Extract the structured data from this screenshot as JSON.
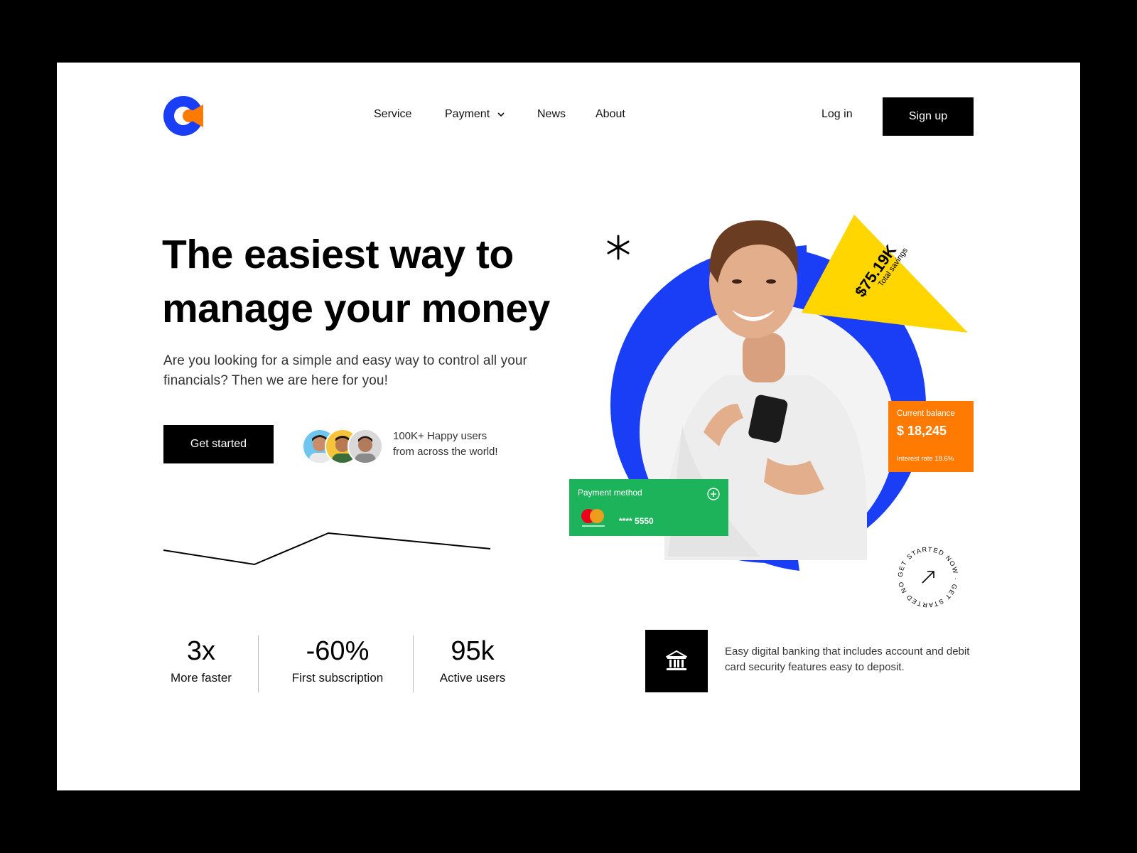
{
  "header": {
    "logo": {
      "icon": "brand-logo-icon",
      "colors": [
        "#1a3ef5",
        "#ff7a00"
      ]
    },
    "nav": [
      {
        "label": "Service"
      },
      {
        "label": "Payment",
        "icon": "chevron-down-icon"
      },
      {
        "label": "News"
      },
      {
        "label": "About"
      }
    ],
    "login_label": "Log in",
    "signup_label": "Sign up"
  },
  "hero": {
    "title": "The easiest way to\nmanage your money",
    "subtitle": "Are you looking for a simple and easy way to control all your financials? Then we are here for you!",
    "cta_label": "Get started",
    "users_line1": "100K+ Happy users",
    "users_line2": "from across the world!"
  },
  "line_chart": {
    "values": [
      20,
      0,
      44,
      22
    ]
  },
  "stats": [
    {
      "value": "3x",
      "label": "More faster"
    },
    {
      "value": "-60%",
      "label": "First subscription"
    },
    {
      "value": "95k",
      "label": "Active users"
    }
  ],
  "feature": {
    "icon": "bank-icon",
    "text": "Easy digital banking that includes account and debit card security features easy to deposit."
  },
  "visual": {
    "savings_value": "$75.19K",
    "savings_label": "Total savings",
    "balance_label": "Current balance",
    "balance_value": "$ 18,245",
    "interest_label": "Interest rate 18.6%",
    "payment_label": "Payment method",
    "card_brand": "mastercard",
    "card_number": "**** 5550",
    "badge_text": "GET STARTED NOW · GET STARTED NOW · ",
    "colors": {
      "blue": "#1a3ef5",
      "yellow": "#ffd600",
      "orange": "#ff7a00",
      "green": "#1db35a"
    }
  }
}
